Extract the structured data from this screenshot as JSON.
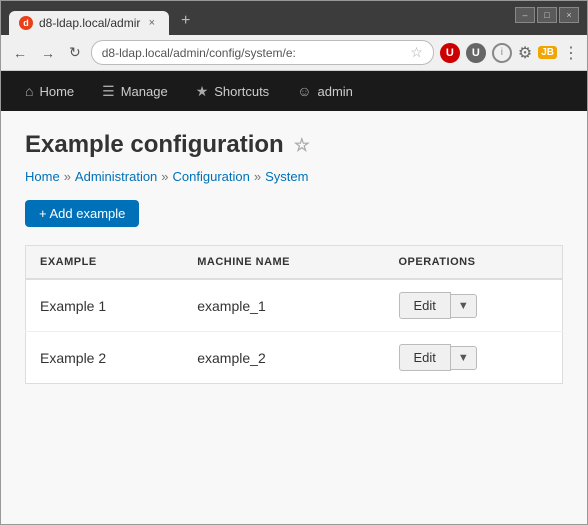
{
  "browser": {
    "tab_title": "d8-ldap.local/admir",
    "tab_close": "×",
    "tab_new": "+",
    "address": "d8-ldap.local/admin/config/system/e:",
    "window_minimize": "–",
    "window_maximize": "□",
    "window_close": "×",
    "ext_up": "U",
    "ext_info": "i",
    "ext_jb": "JB",
    "ext_menu": "⋮"
  },
  "nav": {
    "home_label": "Home",
    "manage_label": "Manage",
    "shortcuts_label": "Shortcuts",
    "admin_label": "admin"
  },
  "page": {
    "title": "Example configuration",
    "title_star": "☆",
    "add_button": "+ Add example",
    "breadcrumb": [
      {
        "label": "Home",
        "link": true
      },
      {
        "label": "Administration",
        "link": true
      },
      {
        "label": "Configuration",
        "link": true
      },
      {
        "label": "System",
        "link": true
      }
    ]
  },
  "table": {
    "columns": [
      "Example",
      "Machine Name",
      "Operations"
    ],
    "rows": [
      {
        "example": "Example 1",
        "machine_name": "example_1",
        "edit_label": "Edit"
      },
      {
        "example": "Example 2",
        "machine_name": "example_2",
        "edit_label": "Edit"
      }
    ]
  }
}
